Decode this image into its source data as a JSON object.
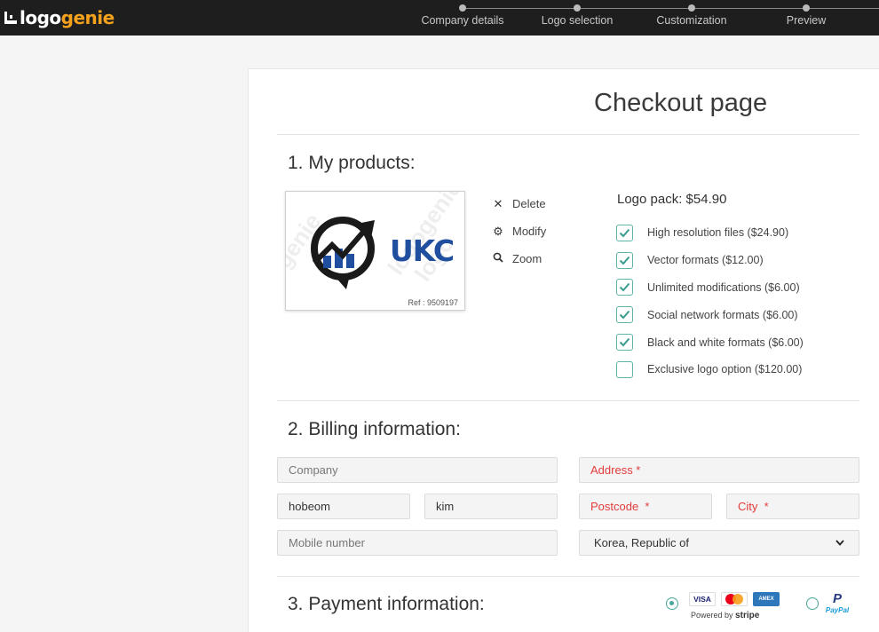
{
  "brand": {
    "part1": "logo",
    "part2": "genie",
    "accent": "#f4a11d"
  },
  "steps": [
    {
      "label": "Company details"
    },
    {
      "label": "Logo selection"
    },
    {
      "label": "Customization"
    },
    {
      "label": "Preview"
    }
  ],
  "page_title": "Checkout page",
  "products": {
    "title": "1. My products:",
    "logo_text": "UKC",
    "ref": "Ref : 9509197",
    "actions": {
      "delete": "Delete",
      "modify": "Modify",
      "zoom": "Zoom"
    },
    "pack_title": "Logo pack: $54.90",
    "options": [
      {
        "label": "High resolution files ($24.90)",
        "checked": true
      },
      {
        "label": "Vector formats ($12.00)",
        "checked": true
      },
      {
        "label": "Unlimited modifications ($6.00)",
        "checked": true
      },
      {
        "label": "Social network formats ($6.00)",
        "checked": true
      },
      {
        "label": "Black and white formats ($6.00)",
        "checked": true
      },
      {
        "label": "Exclusive logo option ($120.00)",
        "checked": false
      }
    ]
  },
  "billing": {
    "title": "2. Billing information:",
    "company_placeholder": "Company",
    "address_placeholder": "Address *",
    "first_name": "hobeom",
    "last_name": "kim",
    "postcode_placeholder": "Postcode  *",
    "city_placeholder": "City  *",
    "mobile_placeholder": "Mobile number",
    "country": "Korea, Republic of"
  },
  "payment": {
    "title": "3. Payment information:",
    "cards": [
      "VISA",
      "MC",
      "AMEX"
    ],
    "powered_by": "Powered by",
    "stripe": "stripe",
    "paypal_mark": "P",
    "paypal": "PayPal",
    "selected": "stripe"
  }
}
